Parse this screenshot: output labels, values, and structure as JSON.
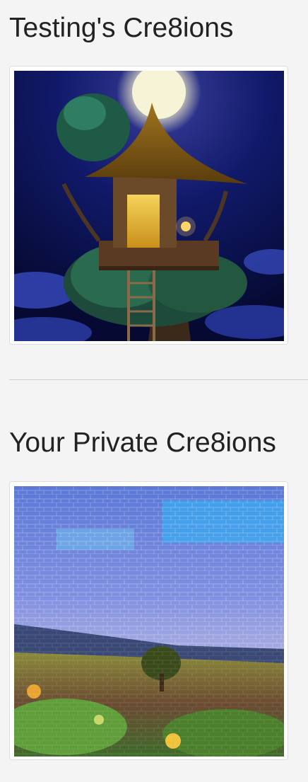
{
  "sections": [
    {
      "title": "Testing's Cre8ions",
      "image_subject": "treehouse-night"
    },
    {
      "title": "Your Private Cre8ions",
      "image_subject": "mosaic-landscape"
    }
  ],
  "colors": {
    "background": "#f4f4f4",
    "text": "#222222",
    "card_border": "#dddddd",
    "divider": "#cfcfcf"
  }
}
